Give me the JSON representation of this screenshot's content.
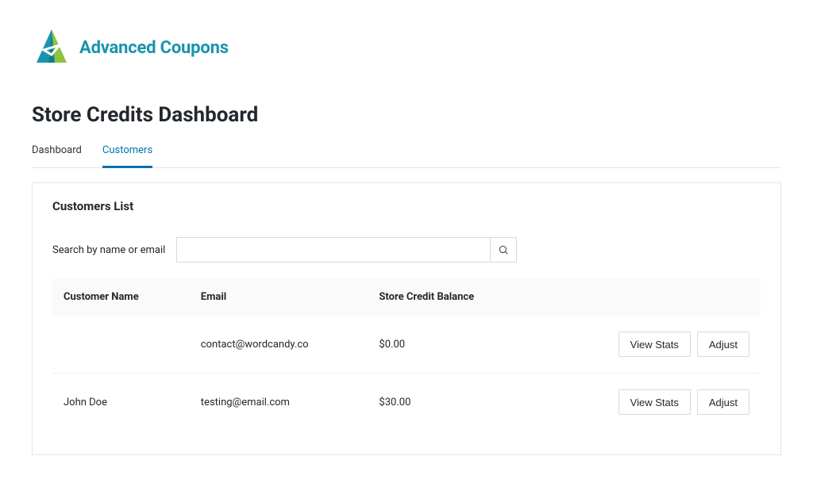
{
  "brand": {
    "name": "Advanced Coupons"
  },
  "page_title": "Store Credits Dashboard",
  "tabs": [
    {
      "label": "Dashboard",
      "active": false
    },
    {
      "label": "Customers",
      "active": true
    }
  ],
  "panel": {
    "title": "Customers List"
  },
  "search": {
    "label": "Search by name or email",
    "value": ""
  },
  "table": {
    "headers": {
      "name": "Customer Name",
      "email": "Email",
      "balance": "Store Credit Balance"
    },
    "rows": [
      {
        "name": "",
        "email": "contact@wordcandy.co",
        "balance": "$0.00",
        "view_label": "View Stats",
        "adjust_label": "Adjust"
      },
      {
        "name": "John Doe",
        "email": "testing@email.com",
        "balance": "$30.00",
        "view_label": "View Stats",
        "adjust_label": "Adjust"
      }
    ]
  }
}
